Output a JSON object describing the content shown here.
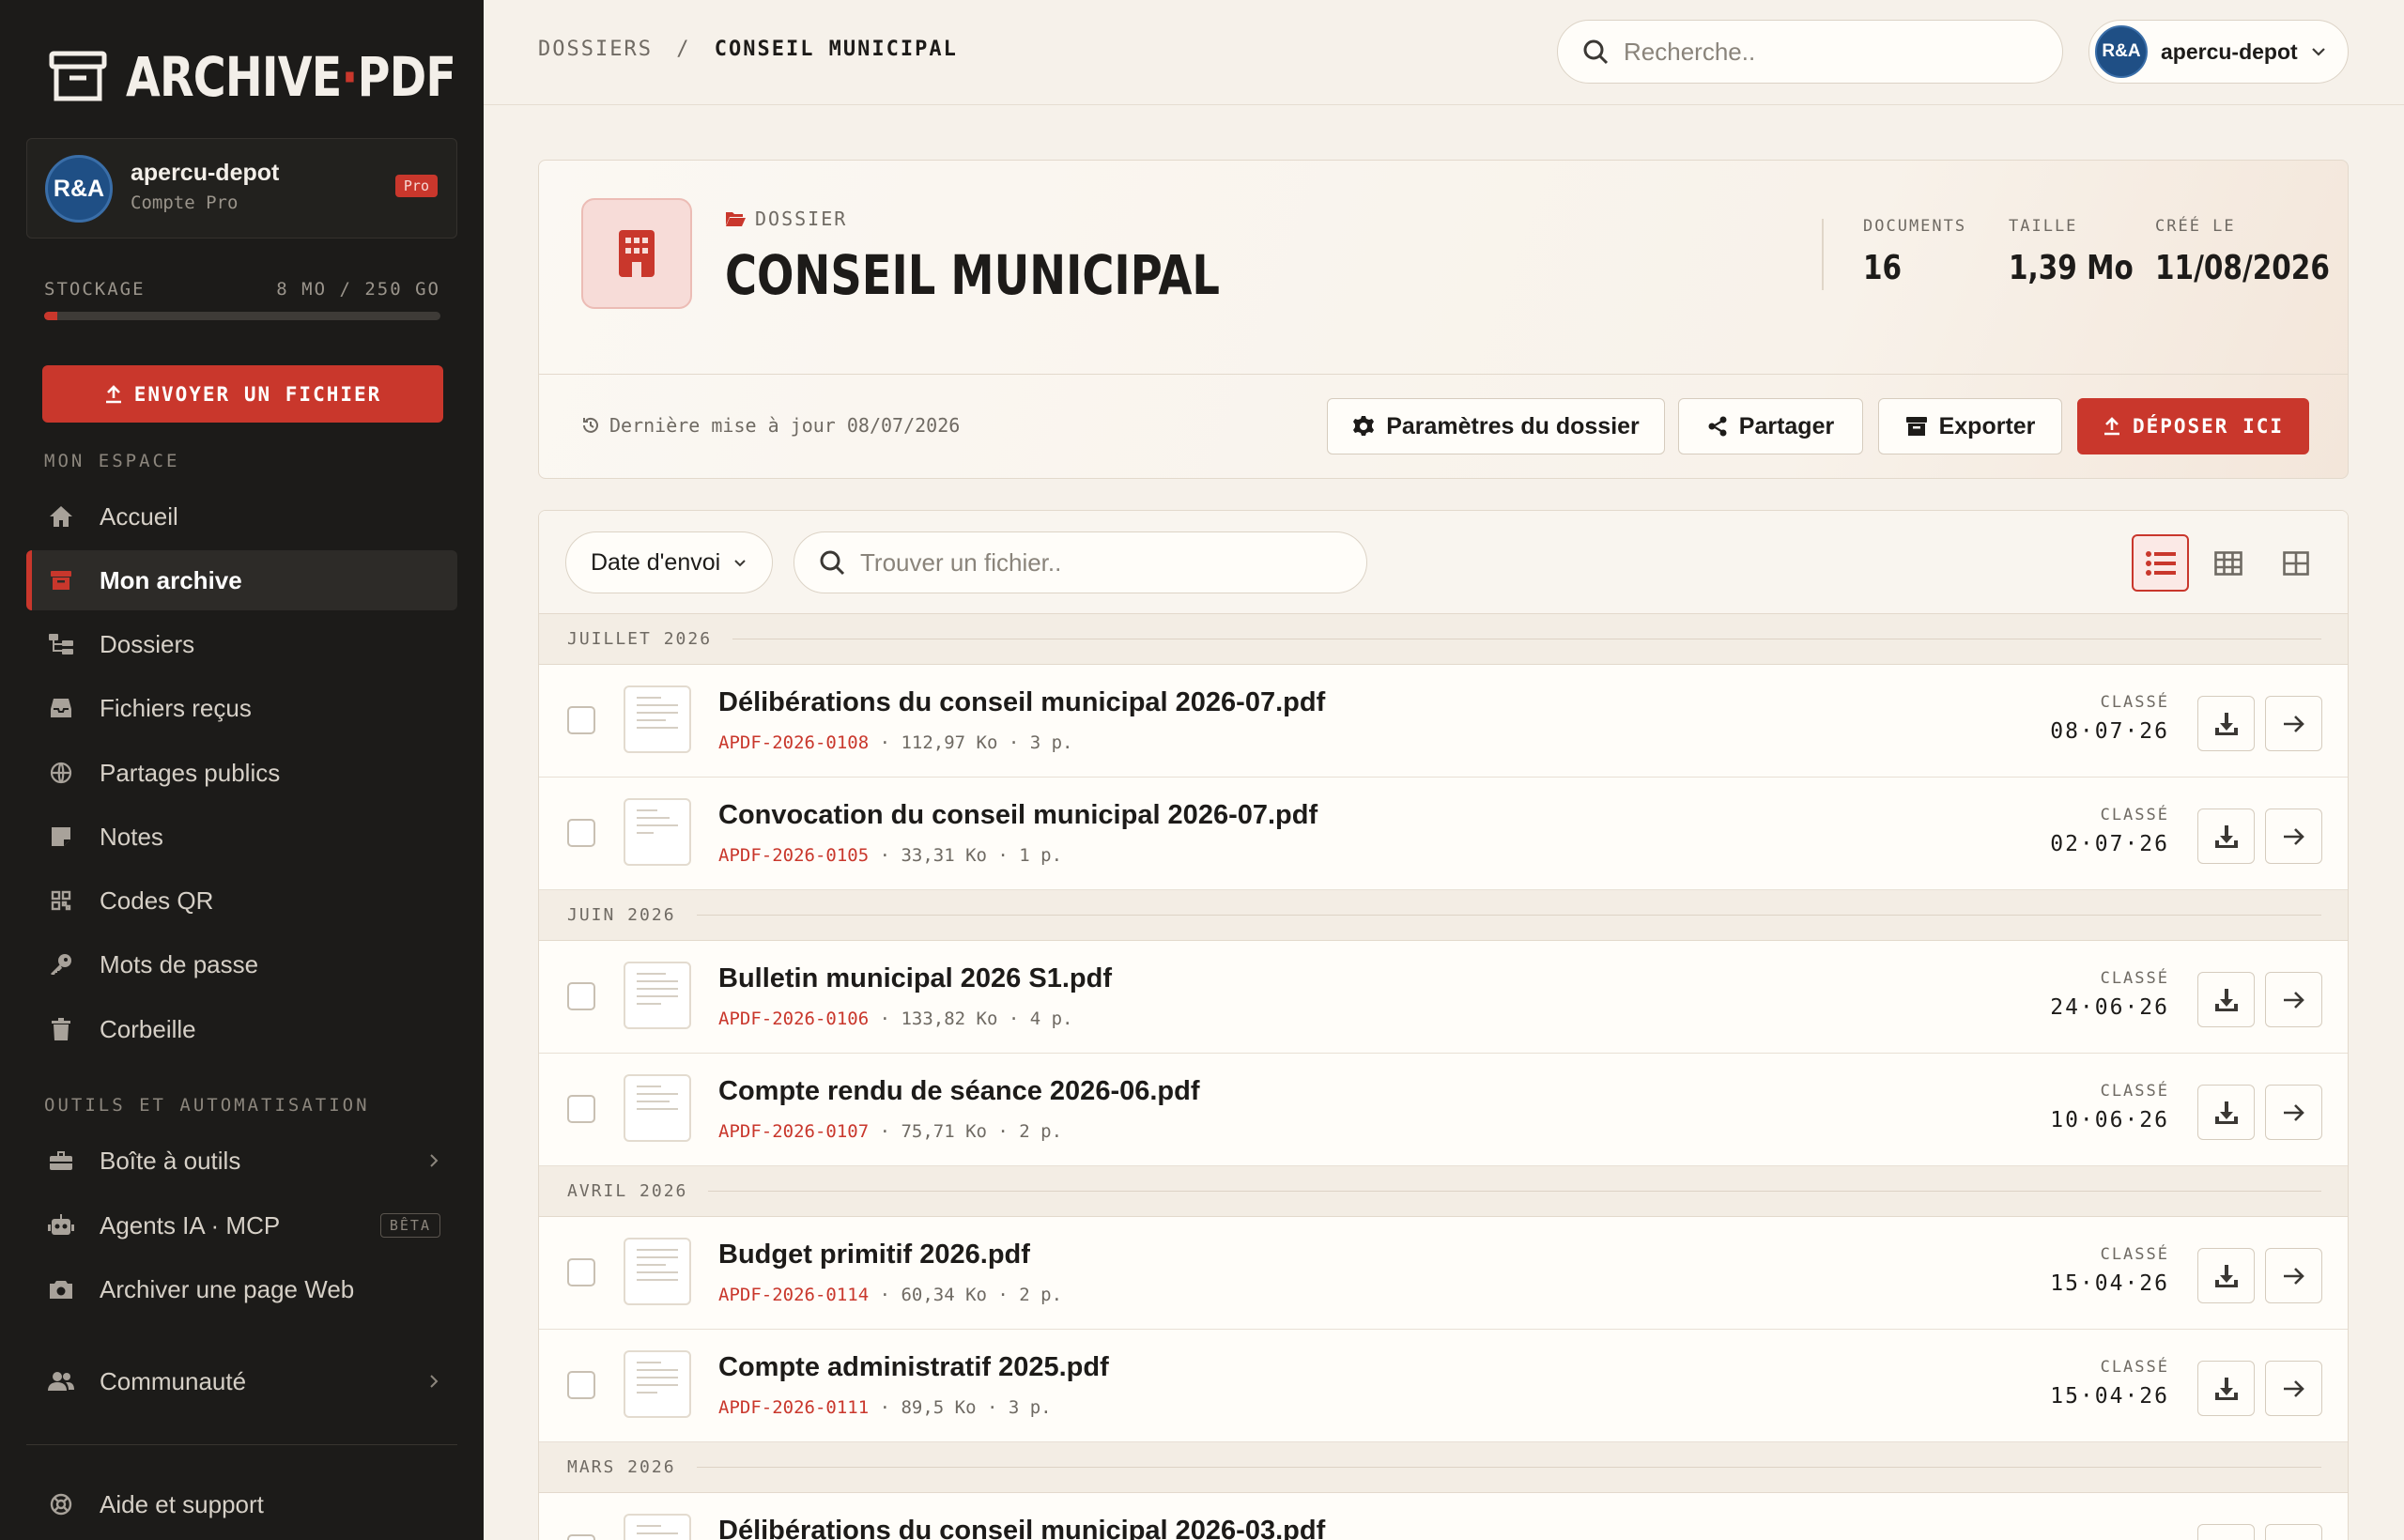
{
  "app": {
    "logo_left": "ARCHIVE",
    "logo_sep": "·",
    "logo_right": "PDF"
  },
  "account": {
    "initials": "R&A",
    "name": "apercu-depot",
    "plan": "Compte Pro",
    "badge": "Pro"
  },
  "storage": {
    "label": "STOCKAGE",
    "value": "8 MO / 250 GO",
    "used_fraction": 0.032
  },
  "upload_label": "ENVOYER UN FICHIER",
  "sections": {
    "space": "MON ESPACE",
    "tools": "OUTILS ET AUTOMATISATION"
  },
  "nav": {
    "home": "Accueil",
    "archive": "Mon archive",
    "folders": "Dossiers",
    "received": "Fichiers reçus",
    "public": "Partages publics",
    "notes": "Notes",
    "qr": "Codes QR",
    "passwords": "Mots de passe",
    "trash": "Corbeille",
    "toolbox": "Boîte à outils",
    "agents": "Agents IA · MCP",
    "agents_badge": "BÊTA",
    "webarchive": "Archiver une page Web",
    "community": "Communauté",
    "help": "Aide et support"
  },
  "topbar": {
    "crumb_root": "DOSSIERS",
    "crumb_sep": "/",
    "crumb_current": "CONSEIL MUNICIPAL",
    "search_placeholder": "Recherche..",
    "user_initials": "R&A",
    "user_name": "apercu-depot"
  },
  "folder": {
    "kicker": "DOSSIER",
    "title": "CONSEIL MUNICIPAL",
    "stats": [
      {
        "label": "DOCUMENTS",
        "value": "16"
      },
      {
        "label": "TAILLE",
        "value": "1,39 Mo"
      },
      {
        "label": "CRÉÉ LE",
        "value": "11/08/2026"
      }
    ],
    "last_update": "Dernière mise à jour 08/07/2026",
    "actions": {
      "settings": "Paramètres du dossier",
      "share": "Partager",
      "export": "Exporter",
      "drop": "DÉPOSER ICI"
    }
  },
  "filters": {
    "sort": "Date d'envoi",
    "find_placeholder": "Trouver un fichier.."
  },
  "groups": [
    "JUILLET 2026",
    "JUIN 2026",
    "AVRIL 2026",
    "MARS 2026"
  ],
  "status_label": "CLASSÉ",
  "files": [
    {
      "name": "Délibérations du conseil municipal 2026-07.pdf",
      "ref": "APDF-2026-0108",
      "meta": " · 112,97 Ko · 3 p.",
      "date": "08·07·26"
    },
    {
      "name": "Convocation du conseil municipal 2026-07.pdf",
      "ref": "APDF-2026-0105",
      "meta": " · 33,31 Ko · 1 p.",
      "date": "02·07·26"
    },
    {
      "name": "Bulletin municipal 2026 S1.pdf",
      "ref": "APDF-2026-0106",
      "meta": " · 133,82 Ko · 4 p.",
      "date": "24·06·26"
    },
    {
      "name": "Compte rendu de séance 2026-06.pdf",
      "ref": "APDF-2026-0107",
      "meta": " · 75,71 Ko · 2 p.",
      "date": "10·06·26"
    },
    {
      "name": "Budget primitif 2026.pdf",
      "ref": "APDF-2026-0114",
      "meta": " · 60,34 Ko · 2 p.",
      "date": "15·04·26"
    },
    {
      "name": "Compte administratif 2025.pdf",
      "ref": "APDF-2026-0111",
      "meta": " · 89,5 Ko · 3 p.",
      "date": "15·04·26"
    },
    {
      "name": "Délibérations du conseil municipal 2026-03.pdf",
      "ref": "",
      "meta": "",
      "date": ""
    }
  ],
  "colors": {
    "accent": "#c9372c",
    "sidebar_bg": "#1c1b19",
    "page_bg": "#f6f1ea"
  }
}
